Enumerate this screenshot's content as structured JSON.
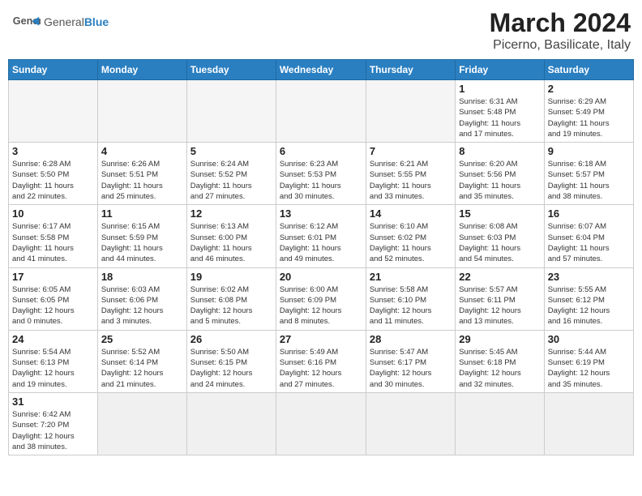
{
  "header": {
    "logo_general": "General",
    "logo_blue": "Blue",
    "month_year": "March 2024",
    "location": "Picerno, Basilicate, Italy"
  },
  "weekdays": [
    "Sunday",
    "Monday",
    "Tuesday",
    "Wednesday",
    "Thursday",
    "Friday",
    "Saturday"
  ],
  "weeks": [
    [
      {
        "day": "",
        "info": ""
      },
      {
        "day": "",
        "info": ""
      },
      {
        "day": "",
        "info": ""
      },
      {
        "day": "",
        "info": ""
      },
      {
        "day": "",
        "info": ""
      },
      {
        "day": "1",
        "info": "Sunrise: 6:31 AM\nSunset: 5:48 PM\nDaylight: 11 hours\nand 17 minutes."
      },
      {
        "day": "2",
        "info": "Sunrise: 6:29 AM\nSunset: 5:49 PM\nDaylight: 11 hours\nand 19 minutes."
      }
    ],
    [
      {
        "day": "3",
        "info": "Sunrise: 6:28 AM\nSunset: 5:50 PM\nDaylight: 11 hours\nand 22 minutes."
      },
      {
        "day": "4",
        "info": "Sunrise: 6:26 AM\nSunset: 5:51 PM\nDaylight: 11 hours\nand 25 minutes."
      },
      {
        "day": "5",
        "info": "Sunrise: 6:24 AM\nSunset: 5:52 PM\nDaylight: 11 hours\nand 27 minutes."
      },
      {
        "day": "6",
        "info": "Sunrise: 6:23 AM\nSunset: 5:53 PM\nDaylight: 11 hours\nand 30 minutes."
      },
      {
        "day": "7",
        "info": "Sunrise: 6:21 AM\nSunset: 5:55 PM\nDaylight: 11 hours\nand 33 minutes."
      },
      {
        "day": "8",
        "info": "Sunrise: 6:20 AM\nSunset: 5:56 PM\nDaylight: 11 hours\nand 35 minutes."
      },
      {
        "day": "9",
        "info": "Sunrise: 6:18 AM\nSunset: 5:57 PM\nDaylight: 11 hours\nand 38 minutes."
      }
    ],
    [
      {
        "day": "10",
        "info": "Sunrise: 6:17 AM\nSunset: 5:58 PM\nDaylight: 11 hours\nand 41 minutes."
      },
      {
        "day": "11",
        "info": "Sunrise: 6:15 AM\nSunset: 5:59 PM\nDaylight: 11 hours\nand 44 minutes."
      },
      {
        "day": "12",
        "info": "Sunrise: 6:13 AM\nSunset: 6:00 PM\nDaylight: 11 hours\nand 46 minutes."
      },
      {
        "day": "13",
        "info": "Sunrise: 6:12 AM\nSunset: 6:01 PM\nDaylight: 11 hours\nand 49 minutes."
      },
      {
        "day": "14",
        "info": "Sunrise: 6:10 AM\nSunset: 6:02 PM\nDaylight: 11 hours\nand 52 minutes."
      },
      {
        "day": "15",
        "info": "Sunrise: 6:08 AM\nSunset: 6:03 PM\nDaylight: 11 hours\nand 54 minutes."
      },
      {
        "day": "16",
        "info": "Sunrise: 6:07 AM\nSunset: 6:04 PM\nDaylight: 11 hours\nand 57 minutes."
      }
    ],
    [
      {
        "day": "17",
        "info": "Sunrise: 6:05 AM\nSunset: 6:05 PM\nDaylight: 12 hours\nand 0 minutes."
      },
      {
        "day": "18",
        "info": "Sunrise: 6:03 AM\nSunset: 6:06 PM\nDaylight: 12 hours\nand 3 minutes."
      },
      {
        "day": "19",
        "info": "Sunrise: 6:02 AM\nSunset: 6:08 PM\nDaylight: 12 hours\nand 5 minutes."
      },
      {
        "day": "20",
        "info": "Sunrise: 6:00 AM\nSunset: 6:09 PM\nDaylight: 12 hours\nand 8 minutes."
      },
      {
        "day": "21",
        "info": "Sunrise: 5:58 AM\nSunset: 6:10 PM\nDaylight: 12 hours\nand 11 minutes."
      },
      {
        "day": "22",
        "info": "Sunrise: 5:57 AM\nSunset: 6:11 PM\nDaylight: 12 hours\nand 13 minutes."
      },
      {
        "day": "23",
        "info": "Sunrise: 5:55 AM\nSunset: 6:12 PM\nDaylight: 12 hours\nand 16 minutes."
      }
    ],
    [
      {
        "day": "24",
        "info": "Sunrise: 5:54 AM\nSunset: 6:13 PM\nDaylight: 12 hours\nand 19 minutes."
      },
      {
        "day": "25",
        "info": "Sunrise: 5:52 AM\nSunset: 6:14 PM\nDaylight: 12 hours\nand 21 minutes."
      },
      {
        "day": "26",
        "info": "Sunrise: 5:50 AM\nSunset: 6:15 PM\nDaylight: 12 hours\nand 24 minutes."
      },
      {
        "day": "27",
        "info": "Sunrise: 5:49 AM\nSunset: 6:16 PM\nDaylight: 12 hours\nand 27 minutes."
      },
      {
        "day": "28",
        "info": "Sunrise: 5:47 AM\nSunset: 6:17 PM\nDaylight: 12 hours\nand 30 minutes."
      },
      {
        "day": "29",
        "info": "Sunrise: 5:45 AM\nSunset: 6:18 PM\nDaylight: 12 hours\nand 32 minutes."
      },
      {
        "day": "30",
        "info": "Sunrise: 5:44 AM\nSunset: 6:19 PM\nDaylight: 12 hours\nand 35 minutes."
      }
    ],
    [
      {
        "day": "31",
        "info": "Sunrise: 6:42 AM\nSunset: 7:20 PM\nDaylight: 12 hours\nand 38 minutes."
      },
      {
        "day": "",
        "info": ""
      },
      {
        "day": "",
        "info": ""
      },
      {
        "day": "",
        "info": ""
      },
      {
        "day": "",
        "info": ""
      },
      {
        "day": "",
        "info": ""
      },
      {
        "day": "",
        "info": ""
      }
    ]
  ]
}
